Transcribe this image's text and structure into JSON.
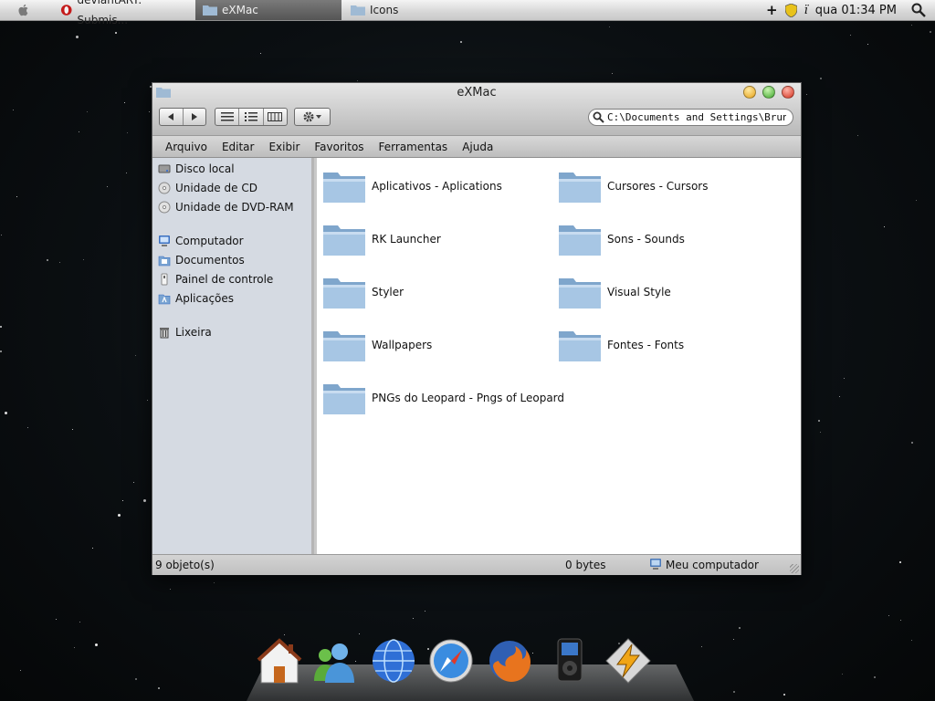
{
  "menubar": {
    "tasks": [
      {
        "label": "deviantART: Submis...",
        "icon": "opera-icon"
      },
      {
        "label": "eXMac",
        "icon": "folder-icon",
        "active": true
      },
      {
        "label": "Icons",
        "icon": "folder-icon"
      }
    ],
    "clock": "qua 01:34 PM"
  },
  "window": {
    "title": "eXMac",
    "search_value": "C:\\Documents and Settings\\Bruno Lu",
    "menu": [
      "Arquivo",
      "Editar",
      "Exibir",
      "Favoritos",
      "Ferramentas",
      "Ajuda"
    ],
    "sidebar": {
      "drives": [
        {
          "label": "Disco local",
          "icon": "hard-disk-icon"
        },
        {
          "label": "Unidade de CD",
          "icon": "cd-icon"
        },
        {
          "label": "Unidade de DVD-RAM",
          "icon": "dvd-icon"
        }
      ],
      "places": [
        {
          "label": "Computador",
          "icon": "computer-icon"
        },
        {
          "label": "Documentos",
          "icon": "documents-icon"
        },
        {
          "label": "Painel de controle",
          "icon": "control-panel-icon"
        },
        {
          "label": "Aplicações",
          "icon": "applications-icon"
        }
      ],
      "trash": {
        "label": "Lixeira",
        "icon": "trash-icon"
      }
    },
    "folders": [
      "Aplicativos - Aplications",
      "Cursores - Cursors",
      "RK Launcher",
      "Sons - Sounds",
      "Styler",
      "Visual Style",
      "Wallpapers",
      "Fontes - Fonts",
      "PNGs do Leopard - Pngs of Leopard"
    ],
    "status": {
      "objects": "9 objeto(s)",
      "size": "0 bytes",
      "location": "Meu computador"
    }
  },
  "dock": [
    "home-icon",
    "messenger-icon",
    "network-globe-icon",
    "safari-icon",
    "firefox-icon",
    "ipod-icon",
    "winamp-icon"
  ],
  "colors": {
    "sidebar": "#d5dae2",
    "folder": "#8fb3d3",
    "desktop": "#0b0f12"
  }
}
